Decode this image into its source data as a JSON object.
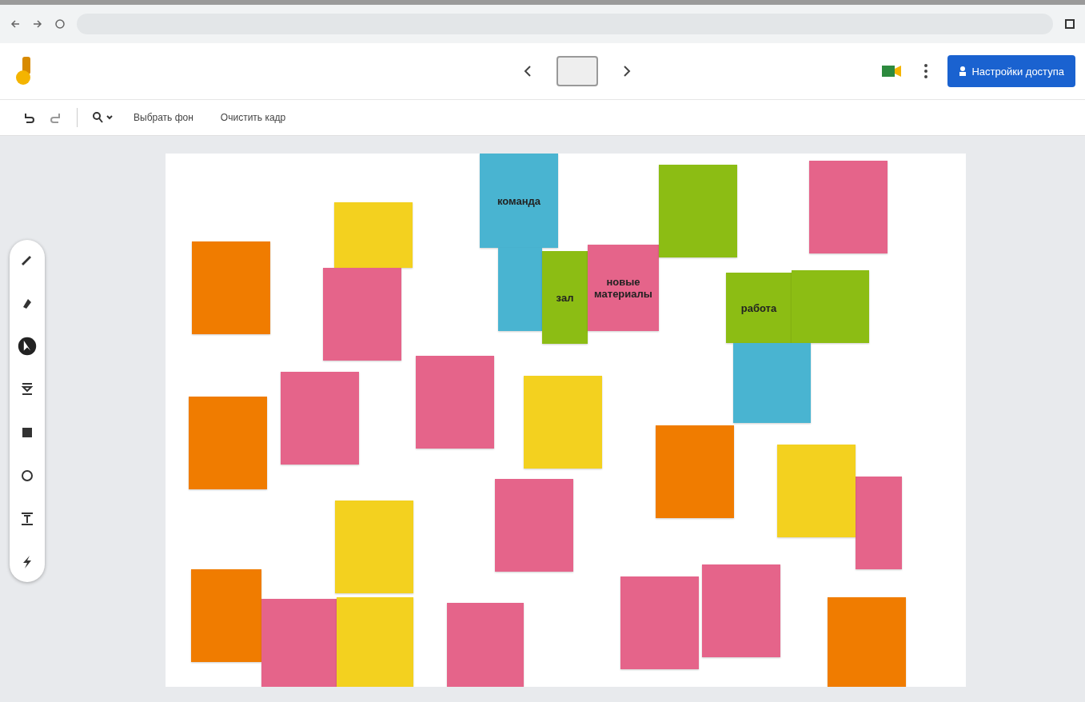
{
  "header": {
    "share_button": "Настройки доступа"
  },
  "toolbar": {
    "items": [
      "Выбрать фон",
      "Очистить кадр"
    ]
  },
  "tools": [
    {
      "kind": "pen",
      "selected": false
    },
    {
      "kind": "eraser",
      "selected": false
    },
    {
      "kind": "select",
      "selected": true
    },
    {
      "kind": "sticky",
      "selected": false
    },
    {
      "kind": "image",
      "selected": false
    },
    {
      "kind": "circle",
      "selected": false
    },
    {
      "kind": "textbox",
      "selected": false
    },
    {
      "kind": "laser",
      "selected": false
    }
  ],
  "notes": [
    {
      "color": "#f07c00"
    },
    {
      "color": "#f3d11f"
    },
    {
      "color": "#e5648a"
    },
    {
      "color": "#49b4d1",
      "text": "команда"
    },
    {
      "color": "#49b4d1"
    },
    {
      "color": "#8cbd14",
      "text": "зал"
    },
    {
      "color": "#e5648a",
      "text": "новые материалы"
    },
    {
      "color": "#8cbd14"
    },
    {
      "color": "#e5648a"
    },
    {
      "color": "#8cbd14",
      "text": "работа"
    },
    {
      "color": "#8cbd14"
    },
    {
      "color": "#49b4d1"
    },
    {
      "color": "#f07c00"
    },
    {
      "color": "#e5648a"
    },
    {
      "color": "#e5648a"
    },
    {
      "color": "#f3d11f"
    },
    {
      "color": "#f07c00"
    },
    {
      "color": "#e5648a"
    },
    {
      "color": "#f3d11f"
    },
    {
      "color": "#e5648a"
    },
    {
      "color": "#f3d11f"
    },
    {
      "color": "#f07c00"
    },
    {
      "color": "#e5648a"
    },
    {
      "color": "#f3d11f"
    },
    {
      "color": "#e5648a"
    },
    {
      "color": "#e5648a"
    },
    {
      "color": "#e5648a"
    },
    {
      "color": "#f07c00"
    }
  ]
}
